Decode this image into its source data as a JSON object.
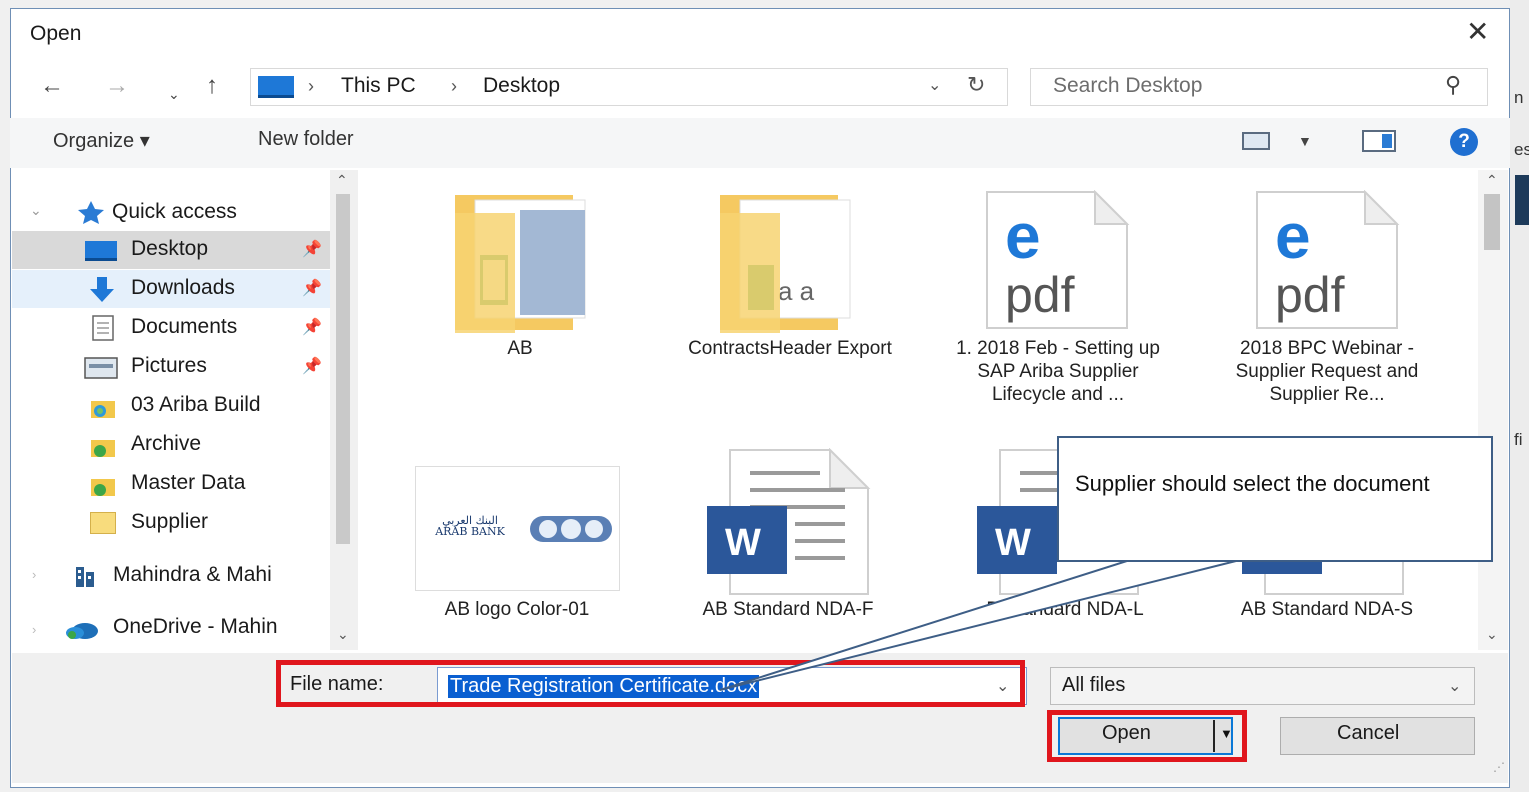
{
  "dialog": {
    "title": "Open"
  },
  "address": {
    "segments": [
      "This PC",
      "Desktop"
    ]
  },
  "search": {
    "placeholder": "Search Desktop"
  },
  "toolbar": {
    "organize": "Organize ▾",
    "new_folder": "New folder"
  },
  "nav": {
    "quick_access": "Quick access",
    "items": [
      {
        "label": "Desktop",
        "icon": "desktop-icon",
        "pinned": true
      },
      {
        "label": "Downloads",
        "icon": "downloads-icon",
        "pinned": true
      },
      {
        "label": "Documents",
        "icon": "documents-icon",
        "pinned": true
      },
      {
        "label": "Pictures",
        "icon": "pictures-icon",
        "pinned": true
      },
      {
        "label": "03 Ariba Build",
        "icon": "sync-folder-icon"
      },
      {
        "label": "Archive",
        "icon": "sync-folder-icon"
      },
      {
        "label": "Master Data",
        "icon": "sync-folder-icon"
      },
      {
        "label": "Supplier",
        "icon": "folder-icon"
      }
    ],
    "mahindra": "Mahindra & Mahi",
    "onedrive": "OneDrive - Mahin"
  },
  "files": [
    {
      "name": "AB",
      "type": "folder"
    },
    {
      "name": "ContractsHeader Export",
      "type": "folder"
    },
    {
      "name": "1. 2018 Feb - Setting up SAP Ariba Supplier Lifecycle and ...",
      "type": "pdf"
    },
    {
      "name": "2018 BPC Webinar - Supplier Request and Supplier Re...",
      "type": "pdf"
    },
    {
      "name": "AB logo Color-01",
      "type": "image"
    },
    {
      "name": "AB Standard NDA-F",
      "type": "word"
    },
    {
      "name": "B Standard NDA-L",
      "type": "word"
    },
    {
      "name": "AB Standard NDA-S",
      "type": "word"
    }
  ],
  "bottom": {
    "file_name_label": "File name:",
    "file_name_value": "Trade Registration Certificate.docx",
    "file_type": "All files",
    "open": "Open",
    "cancel": "Cancel"
  },
  "callout": {
    "text": "Supplier should select the document"
  },
  "logo_text": {
    "arabic": "البنك العربي",
    "english": "ARAB BANK"
  },
  "pdf_label": "pdf",
  "word_label": "W",
  "background_fragments": [
    "n",
    "es",
    "fi"
  ],
  "colors": {
    "highlight_red": "#e0161d",
    "selection_blue": "#0a5fd1",
    "help_blue": "#1f6fd1"
  }
}
